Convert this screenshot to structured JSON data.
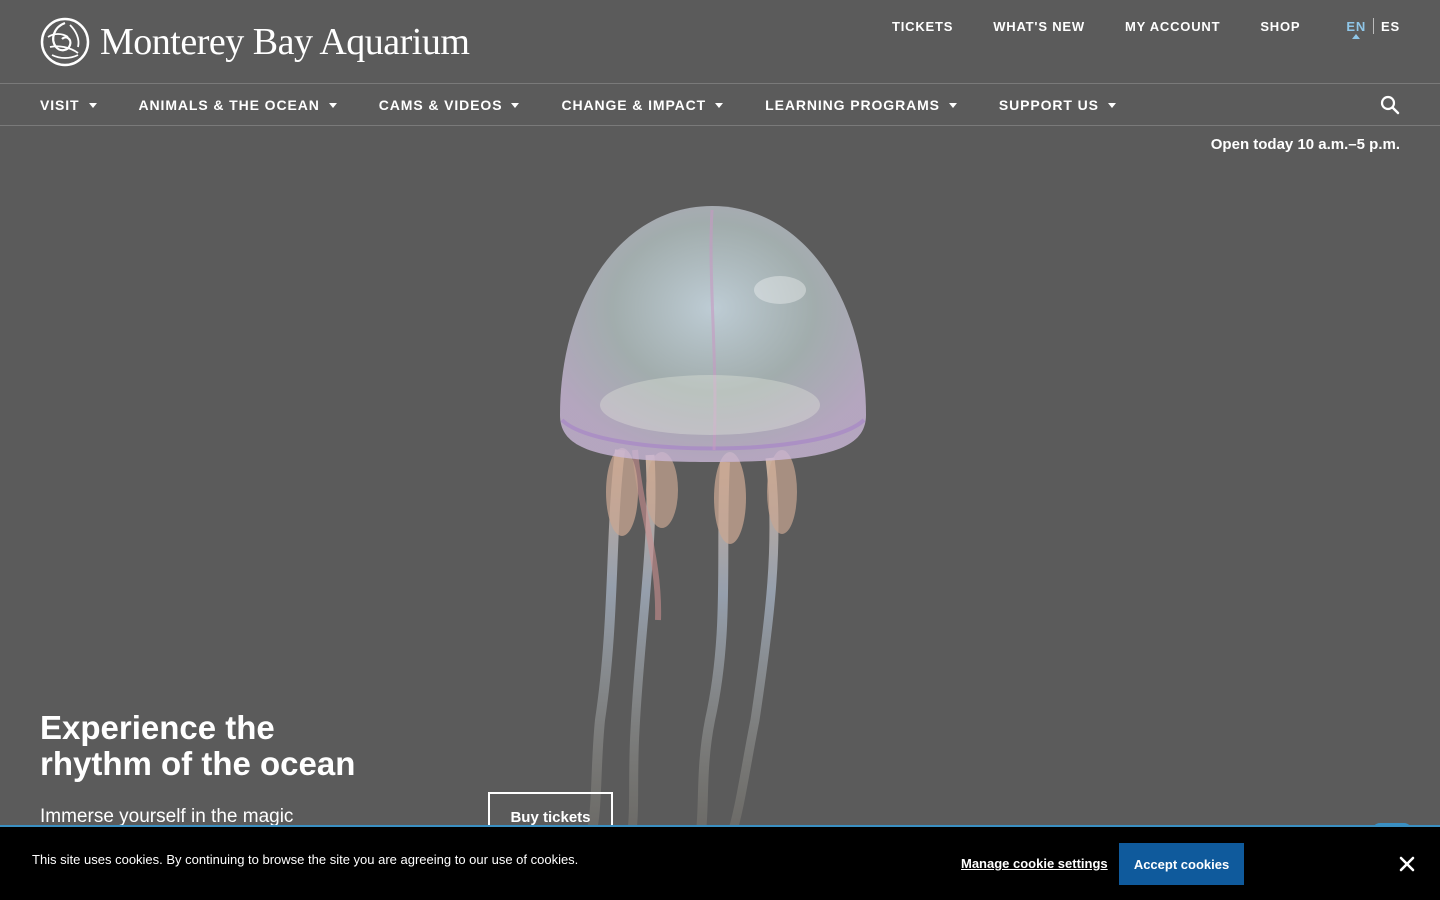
{
  "brand": {
    "name": "Monterey Bay Aquarium",
    "icon": "spiral-shell-logo-icon"
  },
  "util_nav": {
    "items": [
      {
        "label": "TICKETS"
      },
      {
        "label": "WHAT'S NEW"
      },
      {
        "label": "MY ACCOUNT"
      },
      {
        "label": "SHOP"
      }
    ],
    "languages": {
      "current": "EN",
      "other": "ES"
    }
  },
  "main_nav": {
    "items": [
      {
        "label": "VISIT"
      },
      {
        "label": "ANIMALS & THE OCEAN"
      },
      {
        "label": "CAMS & VIDEOS"
      },
      {
        "label": "CHANGE & IMPACT"
      },
      {
        "label": "LEARNING PROGRAMS"
      },
      {
        "label": "SUPPORT US"
      }
    ],
    "search_icon": "search-icon"
  },
  "hero": {
    "hours": "Open today 10 a.m.–5 p.m.",
    "title_line1": "Experience the",
    "title_line2": "rhythm of the ocean",
    "subtitle": "Immerse yourself in the magic",
    "cta": "Buy tickets",
    "image": "jellyfish-illustration"
  },
  "cookie_banner": {
    "message": "This site uses cookies. By continuing to browse the site you are agreeing to our use of cookies.",
    "settings_label": "Manage cookie settings",
    "accept_label": "Accept cookies",
    "close_icon": "close-icon"
  },
  "colors": {
    "background": "#5b5b5b",
    "lang_active": "#8fc6e8",
    "accept_button": "#0f5a9c",
    "cookie_bg": "#000000"
  }
}
